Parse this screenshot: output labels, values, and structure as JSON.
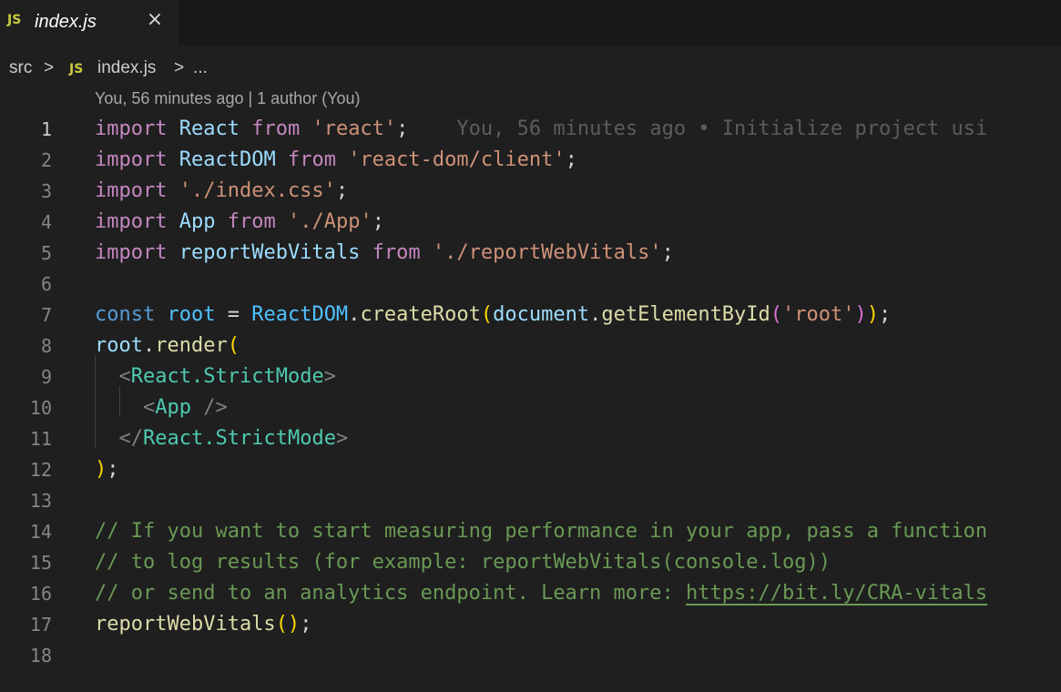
{
  "tab": {
    "icon_label": "JS",
    "title": "index.js",
    "close_icon": "×"
  },
  "breadcrumb": {
    "folder": "src",
    "separator": ">",
    "file_icon_label": "JS",
    "file": "index.js",
    "more": "..."
  },
  "blame": {
    "summary": "You, 56 minutes ago | 1 author (You)",
    "inline": "You, 56 minutes ago • Initialize project usi"
  },
  "line_numbers": [
    "1",
    "2",
    "3",
    "4",
    "5",
    "6",
    "7",
    "8",
    "9",
    "10",
    "11",
    "12",
    "13",
    "14",
    "15",
    "16",
    "17",
    "18"
  ],
  "code": {
    "kw_import": "import",
    "kw_from": "from",
    "kw_const": "const",
    "react": "React",
    "reactdom": "ReactDOM",
    "app": "App",
    "reportwebvitals": "reportWebVitals",
    "root": "root",
    "document": "document",
    "str_react": "'react'",
    "str_reactdom": "'react-dom/client'",
    "str_css": "'./index.css'",
    "str_app": "'./App'",
    "str_rwv": "'./reportWebVitals'",
    "str_root": "'root'",
    "createRoot": "createRoot",
    "getElementById": "getElementById",
    "render": "render",
    "strictmode": "StrictMode",
    "comment_14": "// If you want to start measuring performance in your app, pass a function",
    "comment_15": "// to log results (for example: reportWebVitals(console.log))",
    "comment_16": "// or send to an analytics endpoint. Learn more: ",
    "comment_16_link": "https://bit.ly/CRA-vitals"
  },
  "colors": {
    "background": "#1f1f1f",
    "keyword": "#c586c0",
    "string": "#ce9178",
    "variable": "#9cdcfe",
    "comment": "#6a9955",
    "function": "#dcdcaa",
    "tag": "#4ec9b0"
  }
}
